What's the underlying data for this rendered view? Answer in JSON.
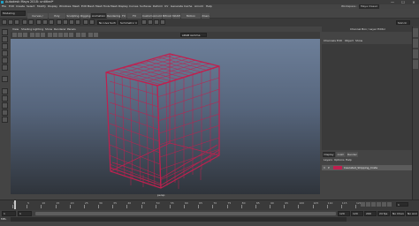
{
  "window": {
    "title": "Autodesk Maya 2018: untitled*",
    "minimize": "—",
    "maximize": "☐",
    "close": "✕"
  },
  "menubar": {
    "items": [
      "File",
      "Edit",
      "Create",
      "Select",
      "Modify",
      "Display",
      "Windows",
      "Mesh",
      "Edit Mesh",
      "Mesh Tools",
      "Mesh Display",
      "Curves",
      "Surfaces",
      "Deform",
      "UV",
      "Generate",
      "Cache",
      "Arnold",
      "Help"
    ],
    "workspace_label": "Workspace :",
    "workspace_value": "Maya Classic"
  },
  "modeset": {
    "value": "Modeling"
  },
  "shelf": {
    "tabs": [
      "Curves / Surfaces",
      "Poly Modeling",
      "Sculpting",
      "Rigging",
      "Animation",
      "Rendering",
      "FX",
      "FX Caching",
      "Custom",
      "Arnold",
      "Bifrost",
      "MASH",
      "Motion Graphics",
      "XGen"
    ],
    "active_index": 4
  },
  "statusline": {
    "no_live_surface": "No Live Surface",
    "symmetry": "Symmetry: Off",
    "sign_in": "Sign In"
  },
  "panel": {
    "menu": [
      "View",
      "Shading",
      "Lighting",
      "Show",
      "Renderer",
      "Panels"
    ],
    "gamma": "sRGB gamma",
    "camera_label": "persp"
  },
  "right_panel": {
    "title": "Channel Box / Layer Editor",
    "menu": [
      "Channels",
      "Edit",
      "Object",
      "Show"
    ],
    "layer_tabs": [
      "Display",
      "Anim",
      "Render"
    ],
    "layer_menu": [
      "Layers",
      "Options",
      "Help"
    ],
    "layer_row": {
      "v": "V",
      "p": "P",
      "name": "Insulated_Shipping_Crate"
    }
  },
  "timeline": {
    "ticks": [
      "1",
      "5",
      "10",
      "15",
      "20",
      "25",
      "30",
      "35",
      "40",
      "45",
      "50",
      "55",
      "60",
      "65",
      "70",
      "75",
      "80",
      "85",
      "90",
      "95",
      "100",
      "105",
      "110",
      "115",
      "120"
    ],
    "current_frame": "1"
  },
  "range": {
    "start": "1",
    "start_inner": "1",
    "end_inner": "120",
    "end": "120",
    "max": "200",
    "fps": "24 fps",
    "char_set": "No Character Set",
    "anim_layer": "No Anim Layer"
  },
  "cmdline": {
    "label": "MEL"
  },
  "colors": {
    "viewport_top": "#6d7f99",
    "viewport_bottom": "#2f343b",
    "wireframe": "#c0204f",
    "maya_icon": "#1fa2c9"
  }
}
